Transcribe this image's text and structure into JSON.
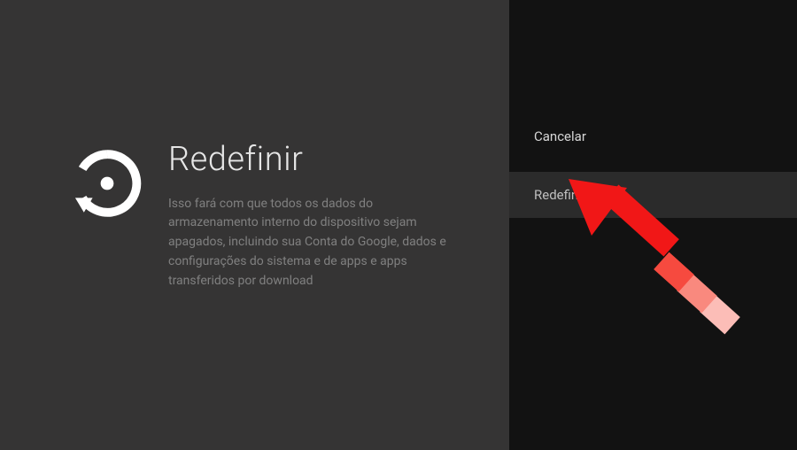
{
  "left": {
    "icon_name": "restore-icon",
    "title": "Redefinir",
    "description": "Isso fará com que todos os dados do armazenamento interno do dispositivo sejam apagados, incluindo sua Conta do Google, dados e configurações do sistema e de apps e apps transferidos por download"
  },
  "right": {
    "cancel_label": "Cancelar",
    "confirm_label": "Redefinir"
  },
  "annotation": {
    "arrow_color_head": "#f11717",
    "arrow_color_tail_1": "#f64a3f",
    "arrow_color_tail_2": "#f9897e",
    "arrow_color_tail_3": "#fcbdb7"
  }
}
